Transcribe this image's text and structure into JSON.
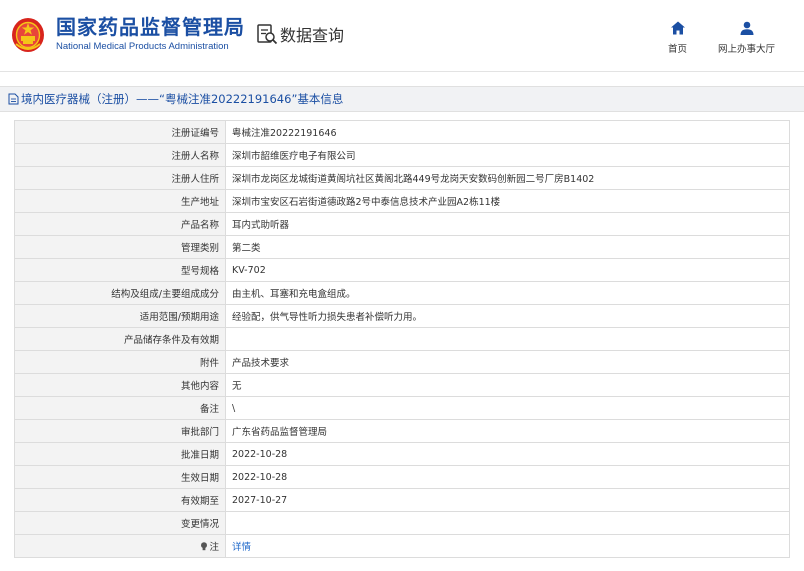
{
  "header": {
    "logo_cn": "国家药品监督管理局",
    "logo_en": "National Medical Products Administration",
    "query_label": "数据查询",
    "nav": [
      {
        "label": "首页",
        "icon": "home-icon"
      },
      {
        "label": "网上办事大厅",
        "icon": "person-icon"
      }
    ]
  },
  "colors": {
    "brand_blue": "#1b4fa3",
    "link_blue": "#1b66c9",
    "emblem_red": "#d8251d",
    "emblem_gold": "#f5c518"
  },
  "title_bar": {
    "text": "境内医疗器械（注册）——“粤械注准20222191646”基本信息"
  },
  "rows": [
    {
      "label": "注册证编号",
      "value": "粤械注准20222191646"
    },
    {
      "label": "注册人名称",
      "value": "深圳市韶维医疗电子有限公司"
    },
    {
      "label": "注册人住所",
      "value": "深圳市龙岗区龙城街道黄阁坑社区黄阁北路449号龙岗天安数码创新园二号厂房B1402"
    },
    {
      "label": "生产地址",
      "value": "深圳市宝安区石岩街道德政路2号中泰信息技术产业园A2栋11楼"
    },
    {
      "label": "产品名称",
      "value": "耳内式助听器"
    },
    {
      "label": "管理类别",
      "value": "第二类"
    },
    {
      "label": "型号规格",
      "value": "KV-702"
    },
    {
      "label": "结构及组成/主要组成成分",
      "value": "由主机、耳塞和充电盒组成。"
    },
    {
      "label": "适用范围/预期用途",
      "value": "经验配，供气导性听力损失患者补偿听力用。"
    },
    {
      "label": "产品储存条件及有效期",
      "value": ""
    },
    {
      "label": "附件",
      "value": "产品技术要求"
    },
    {
      "label": "其他内容",
      "value": "无"
    },
    {
      "label": "备注",
      "value": "\\"
    },
    {
      "label": "审批部门",
      "value": "广东省药品监督管理局"
    },
    {
      "label": "批准日期",
      "value": "2022-10-28"
    },
    {
      "label": "生效日期",
      "value": "2022-10-28"
    },
    {
      "label": "有效期至",
      "value": "2027-10-27"
    },
    {
      "label": "变更情况",
      "value": ""
    }
  ],
  "note_row": {
    "label": "注",
    "link": "详情"
  }
}
